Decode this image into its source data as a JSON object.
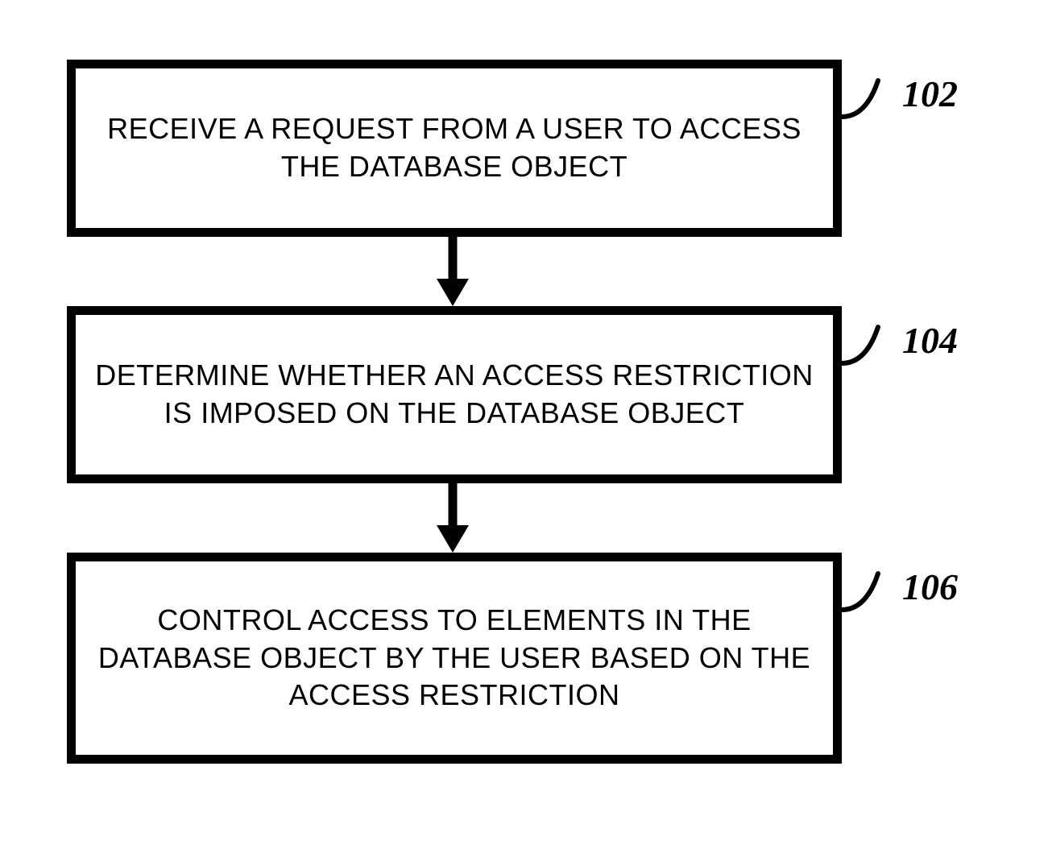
{
  "flowchart": {
    "steps": [
      {
        "ref": "102",
        "text": "RECEIVE A REQUEST FROM A USER TO ACCESS THE DATABASE OBJECT"
      },
      {
        "ref": "104",
        "text": "DETERMINE WHETHER AN ACCESS RESTRICTION IS IMPOSED ON THE DATABASE OBJECT"
      },
      {
        "ref": "106",
        "text": "CONTROL ACCESS TO ELEMENTS IN THE DATABASE OBJECT BY THE USER BASED ON THE ACCESS RESTRICTION"
      }
    ]
  }
}
